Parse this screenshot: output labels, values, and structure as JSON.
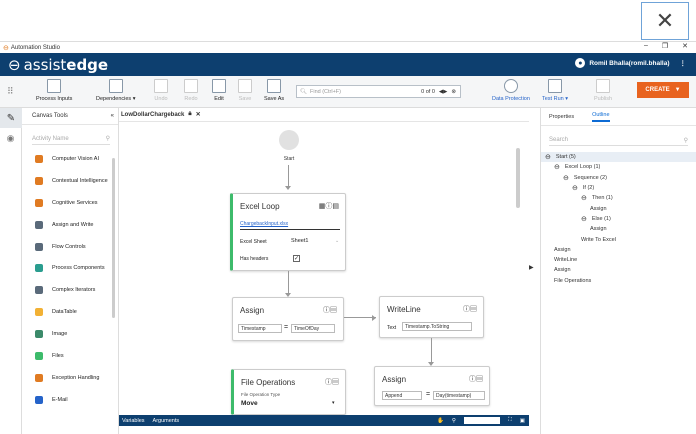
{
  "app": {
    "title": "Automation Studio",
    "brand_light": "assist",
    "brand_bold": "edge",
    "user": "Romil Bhalla(romil.bhalla)"
  },
  "toolbar": {
    "process_inputs": "Process Inputs",
    "dependencies": "Dependencies ▾",
    "undo": "Undo",
    "redo": "Redo",
    "edit": "Edit",
    "save": "Save",
    "save_as": "Save As",
    "search_placeholder": "Find (Ctrl+F)",
    "search_count": "0 of 0",
    "data_protection": "Data Protection",
    "test_run": "Test Run ▾",
    "publish": "Publish",
    "create": "CREATE"
  },
  "tools": {
    "header": "Canvas Tools",
    "search_placeholder": "Activity Name",
    "items": [
      {
        "label": "Computer Vision AI",
        "color": "#e07b22"
      },
      {
        "label": "Contextual Intelligence",
        "color": "#e07b22"
      },
      {
        "label": "Cognitive Services",
        "color": "#e07b22"
      },
      {
        "label": "Assign and Write",
        "color": "#5a6a7a"
      },
      {
        "label": "Flow Controls",
        "color": "#5a6a7a"
      },
      {
        "label": "Process Components",
        "color": "#2a9d8f"
      },
      {
        "label": "Complex Iterators",
        "color": "#5a6a7a"
      },
      {
        "label": "DataTable",
        "color": "#f2b134"
      },
      {
        "label": "Image",
        "color": "#3b8a6a"
      },
      {
        "label": "Files",
        "color": "#3dbb6b"
      },
      {
        "label": "Exception Handling",
        "color": "#e07b22"
      },
      {
        "label": "E-Mail",
        "color": "#2563c9"
      }
    ]
  },
  "canvas": {
    "tab": "LowDollarChargeback",
    "start": "Start",
    "excel_loop": {
      "title": "Excel Loop",
      "file": "ChargebackInput.xlsx",
      "sheet_label": "Excel Sheet",
      "sheet_value": "Sheet1",
      "headers_label": "Has headers"
    },
    "assign1": {
      "title": "Assign",
      "left": "Timestamp",
      "right": "TimeOfDay"
    },
    "writeline": {
      "title": "WriteLine",
      "label": "Text",
      "value": "Timestamp.ToString"
    },
    "file_ops": {
      "title": "File Operations",
      "sub": "File Operation Type",
      "value": "Move"
    },
    "assign2": {
      "title": "Assign",
      "left": "Append",
      "right": "Day(timestamp)"
    }
  },
  "bottom": {
    "variables": "Variables",
    "arguments": "Arguments"
  },
  "right_panel": {
    "tab_properties": "Properties",
    "tab_outline": "Outline",
    "search_placeholder": "Search",
    "outline": [
      {
        "label": "Start (5)",
        "toggle": "⊖",
        "indent": 0
      },
      {
        "label": "Excel Loop (1)",
        "toggle": "⊖",
        "indent": 1
      },
      {
        "label": "Sequence (2)",
        "toggle": "⊖",
        "indent": 2
      },
      {
        "label": "If (2)",
        "toggle": "⊖",
        "indent": 3
      },
      {
        "label": "Then (1)",
        "toggle": "⊖",
        "indent": 4
      },
      {
        "label": "Assign",
        "toggle": "",
        "indent": 5
      },
      {
        "label": "Else (1)",
        "toggle": "⊖",
        "indent": 4
      },
      {
        "label": "Assign",
        "toggle": "",
        "indent": 5
      },
      {
        "label": "Write To Excel",
        "toggle": "",
        "indent": 4
      },
      {
        "label": "Assign",
        "toggle": "",
        "indent": 1
      },
      {
        "label": "WriteLine",
        "toggle": "",
        "indent": 1
      },
      {
        "label": "Assign",
        "toggle": "",
        "indent": 1
      },
      {
        "label": "File Operations",
        "toggle": "",
        "indent": 1
      }
    ]
  }
}
